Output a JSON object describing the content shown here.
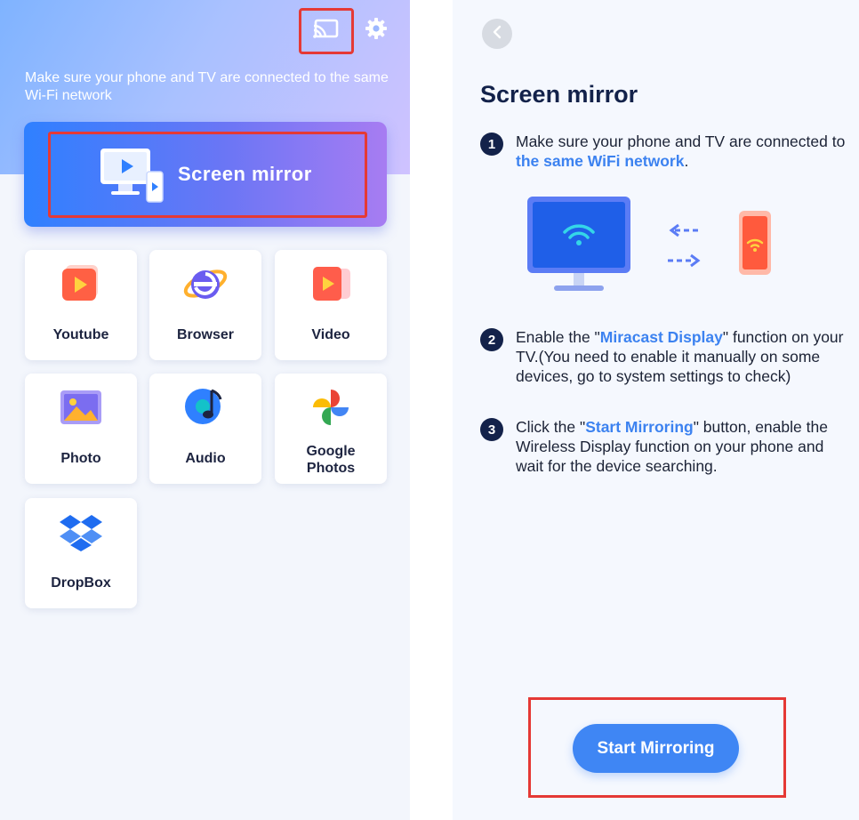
{
  "left": {
    "hint": "Make sure your phone and TV are connected to the same Wi-Fi network",
    "mirror_label": "Screen mirror",
    "tiles": [
      {
        "label": "Youtube",
        "icon": "youtube-icon"
      },
      {
        "label": "Browser",
        "icon": "browser-icon"
      },
      {
        "label": "Video",
        "icon": "video-icon"
      },
      {
        "label": "Photo",
        "icon": "photo-icon"
      },
      {
        "label": "Audio",
        "icon": "audio-icon"
      },
      {
        "label": "Google Photos",
        "icon": "google-photos-icon"
      },
      {
        "label": "DropBox",
        "icon": "dropbox-icon"
      }
    ]
  },
  "right": {
    "title": "Screen mirror",
    "steps": [
      {
        "number": "1",
        "pre": "Make sure your phone and TV are connected to ",
        "highlight": "the same WiFi network",
        "post": "."
      },
      {
        "number": "2",
        "pre": "Enable the \"",
        "highlight": "Miracast Display",
        "post": "\" function on your TV.(You need to enable it manually on some devices, go to system settings to check)"
      },
      {
        "number": "3",
        "pre": "Click the \"",
        "highlight": "Start Mirroring",
        "post": "\" button, enable the Wireless Display function on your phone and wait for the device searching."
      }
    ],
    "start_button": "Start Mirroring"
  },
  "colors": {
    "accent": "#3f86f4",
    "highlight_text": "#3c82f0",
    "annotation_red": "#e53935",
    "title_navy": "#13224a"
  }
}
